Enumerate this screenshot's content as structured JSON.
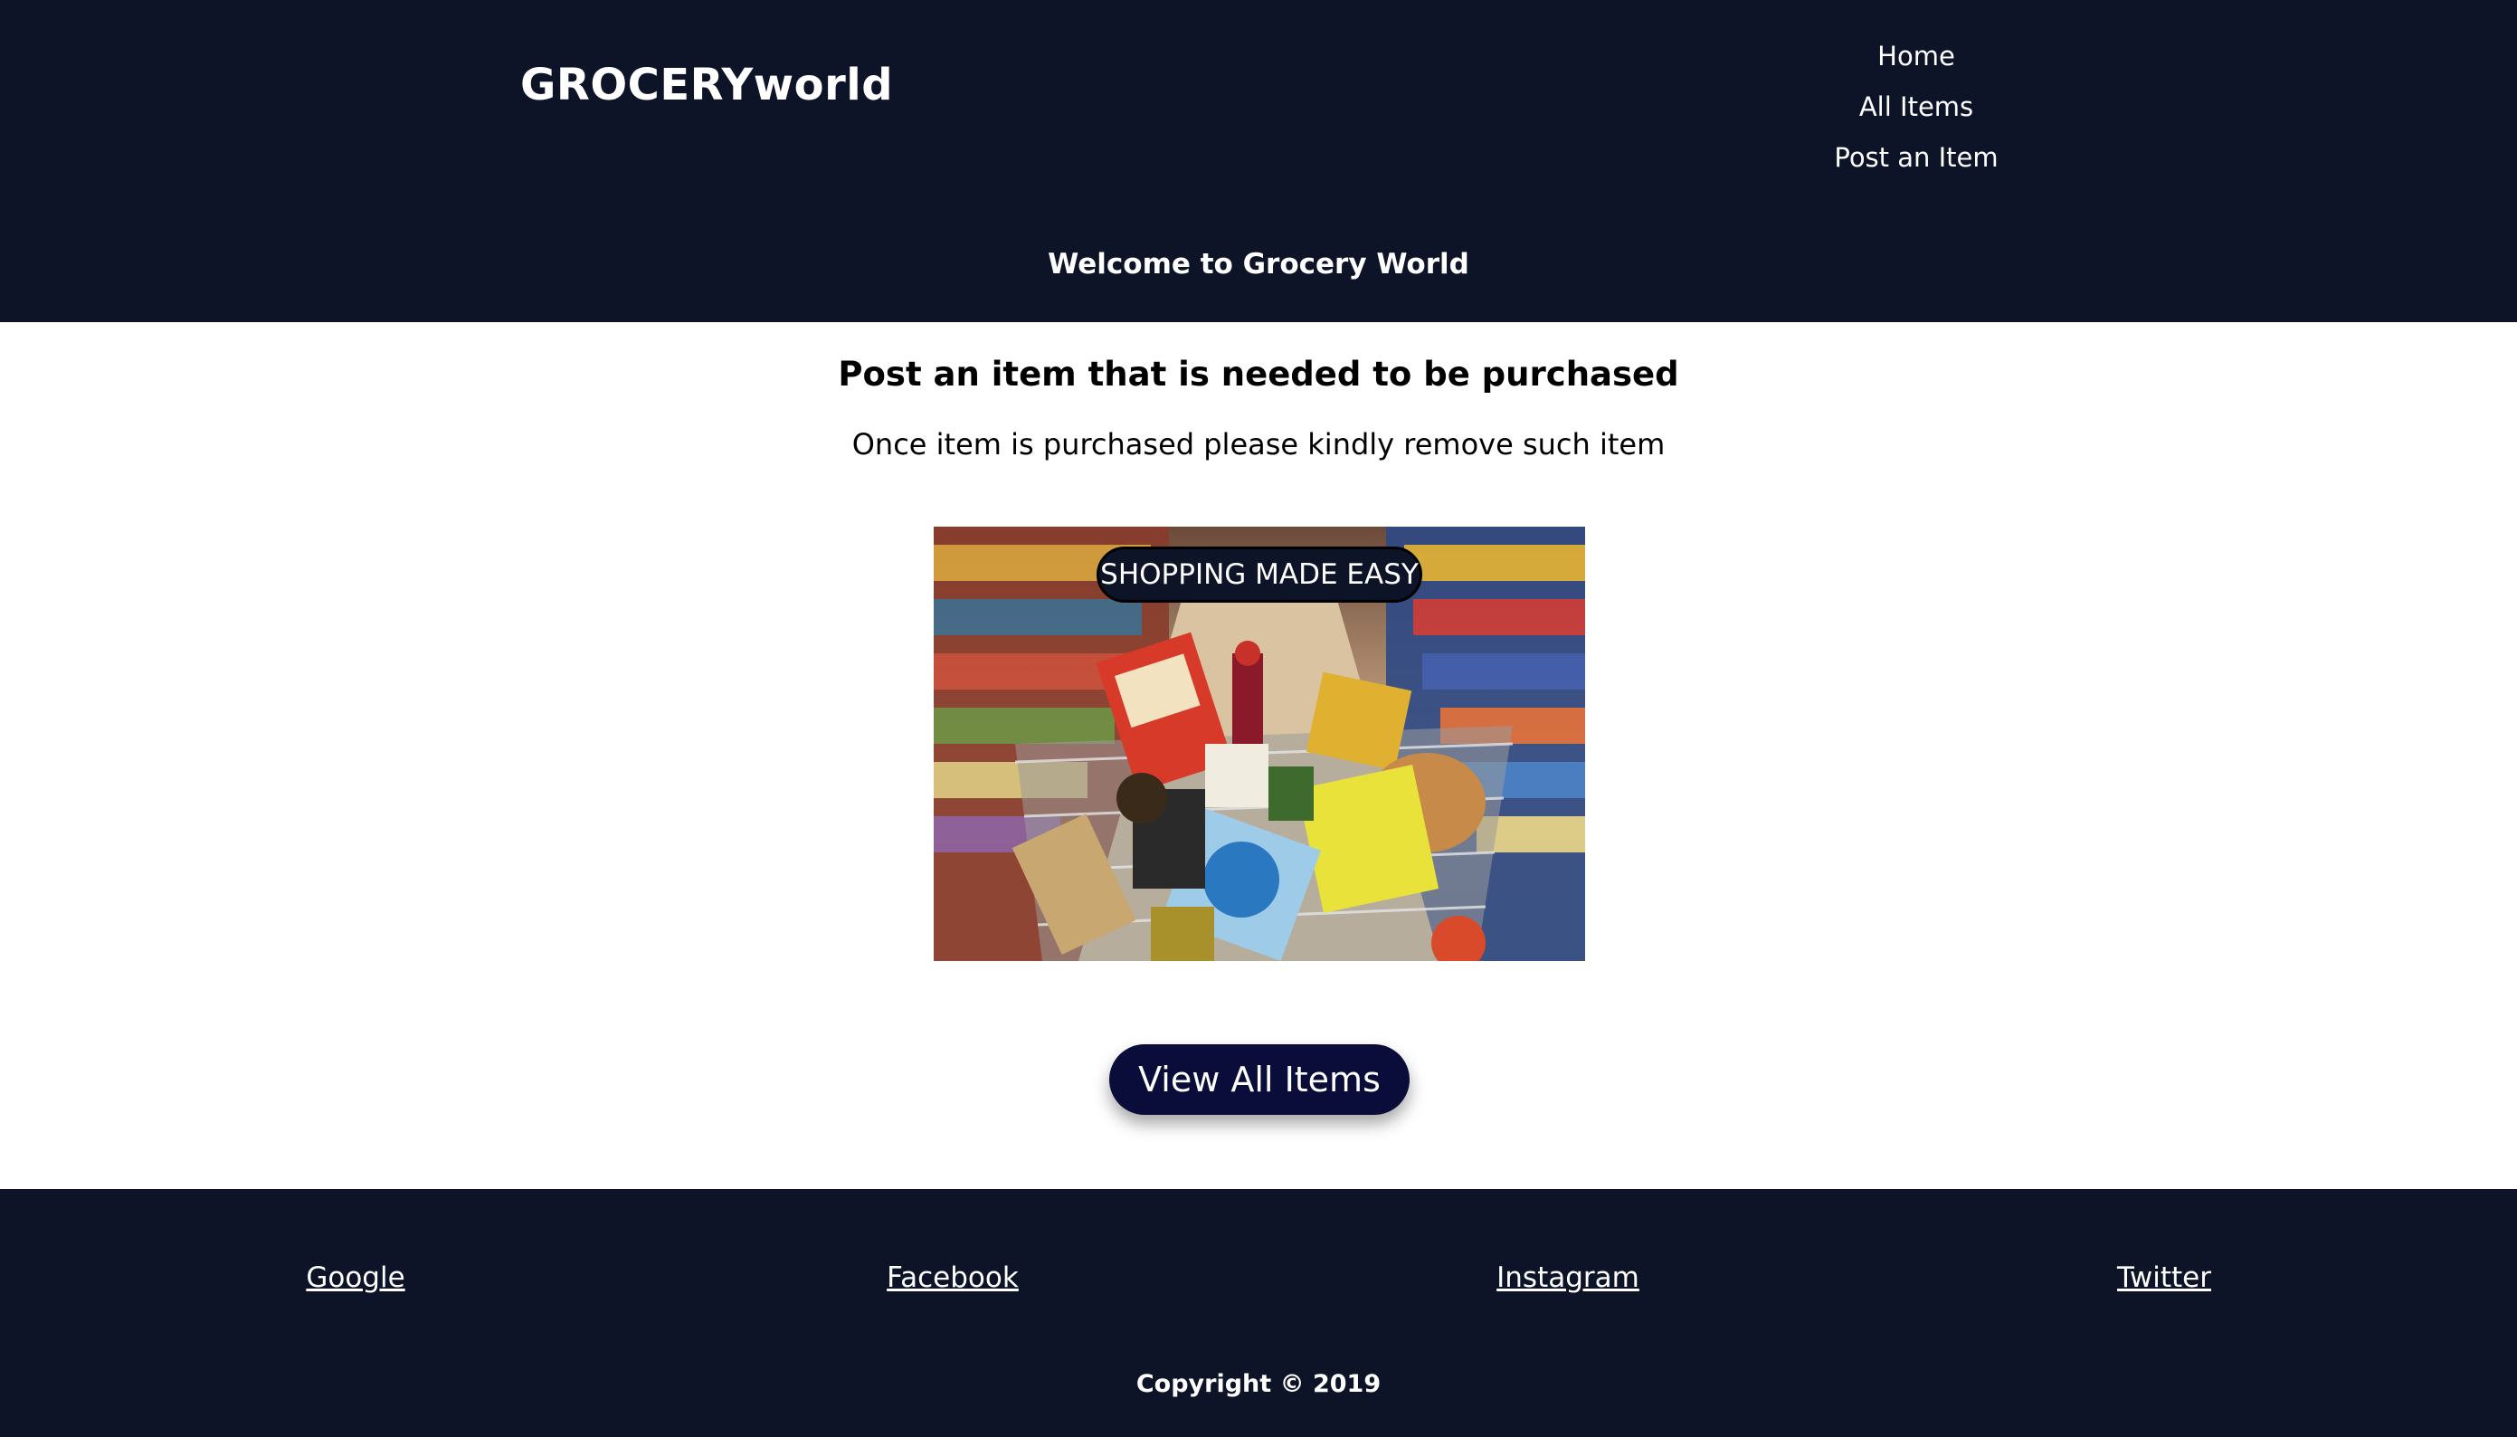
{
  "header": {
    "brand": "GROCERYworld",
    "nav": [
      "Home",
      "All Items",
      "Post an Item"
    ],
    "welcome": "Welcome to Grocery World"
  },
  "main": {
    "title": "Post an item that is needed to be purchased",
    "subtitle": "Once item is purchased please kindly remove such item",
    "hero_badge": "SHOPPING MADE EASY",
    "cta_label": "View All Items"
  },
  "footer": {
    "links": [
      "Google",
      "Facebook",
      "Instagram",
      "Twitter"
    ],
    "copyright": "Copyright © 2019"
  },
  "colors": {
    "header_bg": "#0e1428",
    "cta_bg": "#0a0d3a",
    "text_light": "#ffffff"
  }
}
